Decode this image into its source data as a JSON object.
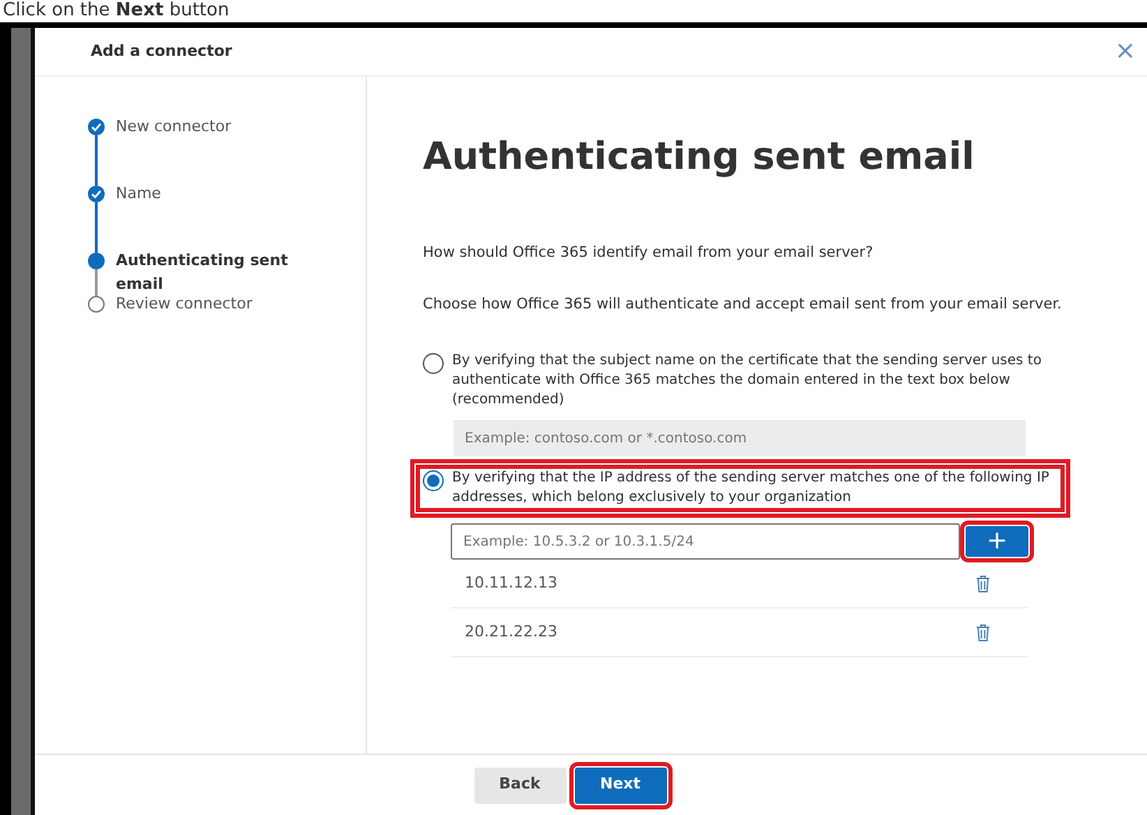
{
  "caption": "Click on the **Next** button",
  "dialog": {
    "title": "Add a connector",
    "close": "×"
  },
  "steps": [
    {
      "label": "New connector",
      "completed": true,
      "selected": false
    },
    {
      "label": "Name",
      "completed": true,
      "selected": false
    },
    {
      "label": "Authenticating sent email",
      "completed": false,
      "selected": true
    },
    {
      "label": "Review connector",
      "completed": false,
      "selected": false
    }
  ],
  "heading": "Authenticating sent email",
  "question": "How should Office 365 identify email from your email server?",
  "instruction": "Choose how Office 365 will authenticate and accept email sent from your email server.",
  "options": [
    {
      "label": "By verifying that the subject name on the certificate that the sending server uses to authenticate with Office 365 matches the domain entered in the text box below (recommended)",
      "selected": false,
      "highlighted": false,
      "placeholder": "Example: contoso.com or *.contoso.com"
    },
    {
      "label": "By verifying that the IP address of the sending server matches one of the following IP addresses, which belong exclusively to your organization",
      "selected": true,
      "highlighted": true,
      "placeholder": "Example: 10.5.3.2 or 10.3.1.5/24"
    }
  ],
  "add_button": {
    "label": "+",
    "highlighted": true
  },
  "ip_addresses": [
    "10.11.12.13",
    "20.21.22.23"
  ],
  "buttons": [
    {
      "label": "Back",
      "kind": "secondary",
      "highlighted": false
    },
    {
      "label": "Next",
      "kind": "primary",
      "highlighted": true
    }
  ]
}
